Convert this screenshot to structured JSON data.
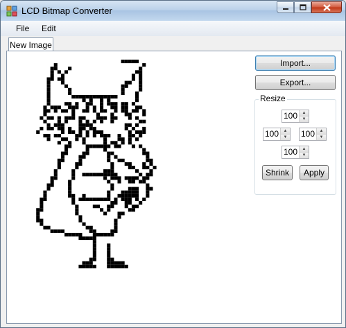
{
  "window": {
    "title": "LCD Bitmap Converter"
  },
  "menu": {
    "file": "File",
    "edit": "Edit"
  },
  "tabs": [
    {
      "label": "New Image"
    }
  ],
  "buttons": {
    "import": "Import...",
    "export": "Export...",
    "shrink": "Shrink",
    "apply": "Apply"
  },
  "resize": {
    "title": "Resize",
    "top": "100",
    "left": "100",
    "right": "100",
    "bottom": "100"
  },
  "icons": {
    "app": "app-icon",
    "minimize": "minimize-icon",
    "maximize": "maximize-icon",
    "close": "close-icon"
  },
  "bitmap_rows": [
    "..........................#####.......",
    ".......#........................#.....",
    "......##...#...................#......",
    "......#.#.#...................##......",
    "......#..#...................#.#......",
    ".....##.##...................#.#......",
    ".....#...#.................##..#......",
    ".....#....#...............##...#......",
    ".....#.....#..............#....#......",
    ".....#.....#..............#...#.......",
    ".....#......#############.....#.......",
    ".....#.........#.#..#.#.......#.......",
    ".....#....##.#..##..#.###.##.#........",
    "....#.###..###..#.#.#..##.##..##......",
    "....##.#.##.#..##.#.##..#.##.##.#.....",
    "....#.......#......#...#...##...#.....",
    "...#.##.#.###.##...###.##...#.#.......",
    "....#...#.#...#.#.#.#..#.......##.....",
    ".....#.###....####.........##.#.......",
    "...#.##.##.#..##.##........#.#..#.....",
    "..#......#.##.#.#.###.......#.###.....",
    "....##.##....##.#.#.###..#..##.#......",
    ".....#...##..#.#.....#...##.#.#.......",
    "........#..#...#.....#.##.#.#.........",
    "..........##....#######.##...#.#......",
    "..........#.....#....#..........#.....",
    ".........##....##.....##........##....",
    ".........#....##......#.#........#....",
    "........##....#.......#..##......##...",
    "........#....##........#...##...#.#...",
    "........#....#.........#....##..##.#..",
    ".......#....#........###......#...#...",
    ".......#....#..##########......#.##...",
    "......##....#........#.###.####.##....",
    "......#....#..........#..#..##.##.....",
    ".....##....#...........#.........#....",
    ".....#.....#...........#....###..##...",
    "....#......#..........#...#####..#....",
    "....#......##..#......#..######..#....",
    "...##.......#.#########.#.###.#.#.....",
    "...#........#..........##..##..#......",
    "...#.........#....##..##...#.##.......",
    "..##.........#......#.#.....##........",
    "..#..........#.......#...##...........",
    "..#...........#..........#............",
    "..##..........#.........#.............",
    "...#...........#........#.............",
    "....##..........##......#.............",
    "......####.......##....##.............",
    "..........#####...######..............",
    "..............#####...................",
    "..................#...................",
    "..................#...#...............",
    "..................#...#...............",
    "..................#...#...............",
    "..................#...#...............",
    ".................##...##..............",
    "...............###....#####...........",
    "..............#####...######.........."
  ]
}
